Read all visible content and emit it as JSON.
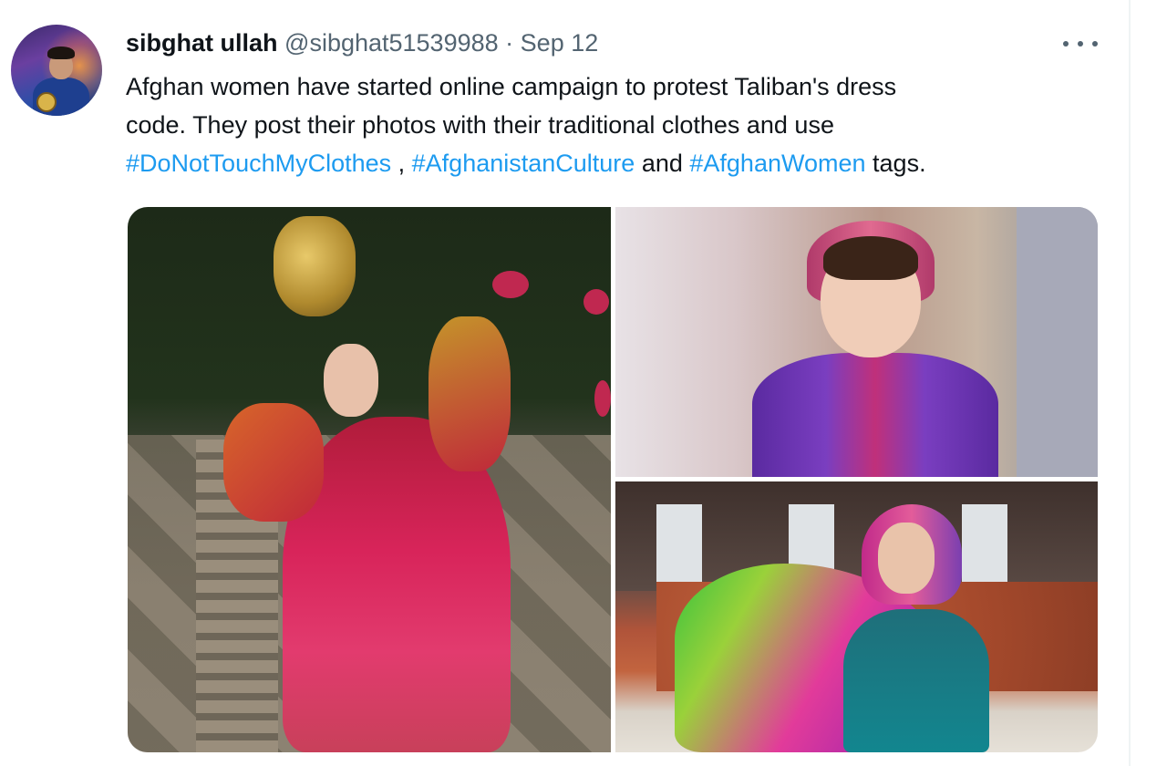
{
  "tweet": {
    "author": {
      "name": "sibghat ullah",
      "handle": "@sibghat51539988",
      "separator": "·",
      "date": "Sep 12"
    },
    "more_icon": "more-horizontal-icon",
    "text": {
      "line1": "Afghan women have started online campaign to protest Taliban's dress",
      "line2": "code. They post their photos with their traditional clothes and use",
      "line3": {
        "hashtag1": "#DoNotTouchMyClothes",
        "sep1": " , ",
        "hashtag2": "#AfghanistanCulture",
        "sep2": " and ",
        "hashtag3": "#AfghanWomen",
        "tail": " tags."
      }
    },
    "colors": {
      "text": "#0f1419",
      "muted": "#536471",
      "link": "#1d9bf0"
    },
    "media": {
      "count": 3
    }
  }
}
